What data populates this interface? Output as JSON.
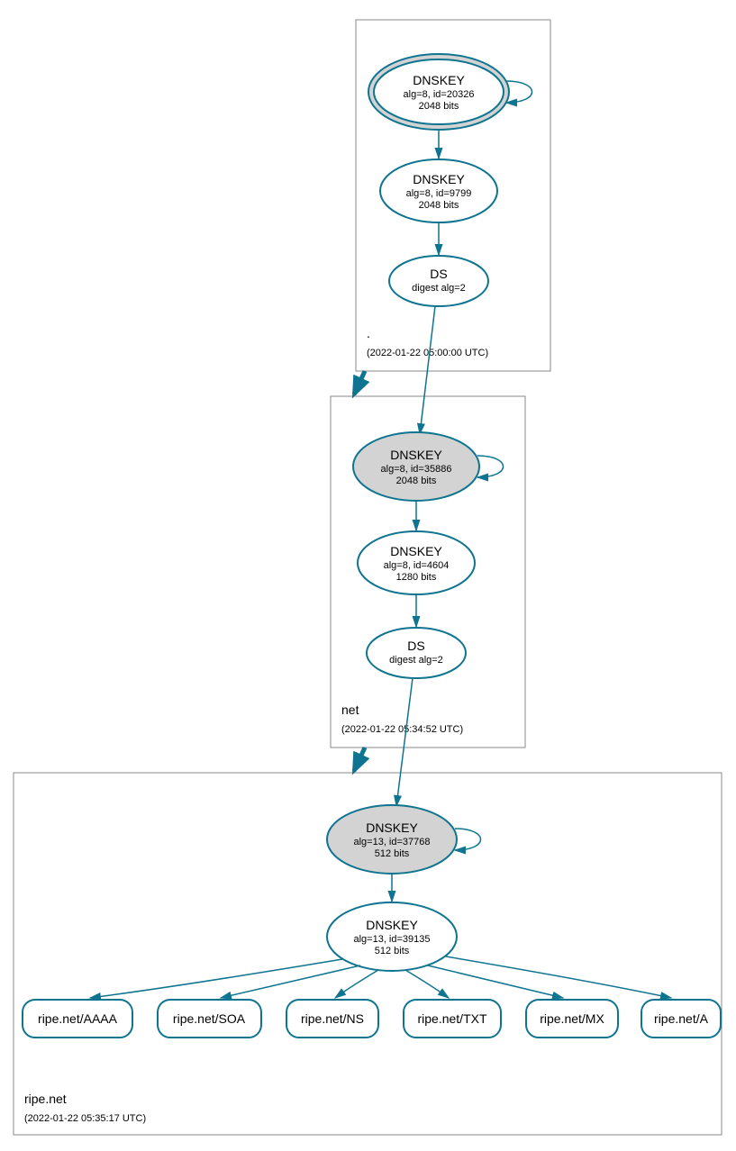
{
  "zones": {
    "root": {
      "label": ".",
      "timestamp": "(2022-01-22 05:00:00 UTC)",
      "dnskey1": {
        "title": "DNSKEY",
        "line1": "alg=8, id=20326",
        "line2": "2048 bits"
      },
      "dnskey2": {
        "title": "DNSKEY",
        "line1": "alg=8, id=9799",
        "line2": "2048 bits"
      },
      "ds": {
        "title": "DS",
        "line1": "digest alg=2"
      }
    },
    "net": {
      "label": "net",
      "timestamp": "(2022-01-22 05:34:52 UTC)",
      "dnskey1": {
        "title": "DNSKEY",
        "line1": "alg=8, id=35886",
        "line2": "2048 bits"
      },
      "dnskey2": {
        "title": "DNSKEY",
        "line1": "alg=8, id=4604",
        "line2": "1280 bits"
      },
      "ds": {
        "title": "DS",
        "line1": "digest alg=2"
      }
    },
    "ripe": {
      "label": "ripe.net",
      "timestamp": "(2022-01-22 05:35:17 UTC)",
      "dnskey1": {
        "title": "DNSKEY",
        "line1": "alg=13, id=37768",
        "line2": "512 bits"
      },
      "dnskey2": {
        "title": "DNSKEY",
        "line1": "alg=13, id=39135",
        "line2": "512 bits"
      }
    }
  },
  "records": {
    "aaaa": "ripe.net/AAAA",
    "soa": "ripe.net/SOA",
    "ns": "ripe.net/NS",
    "txt": "ripe.net/TXT",
    "mx": "ripe.net/MX",
    "a": "ripe.net/A"
  }
}
